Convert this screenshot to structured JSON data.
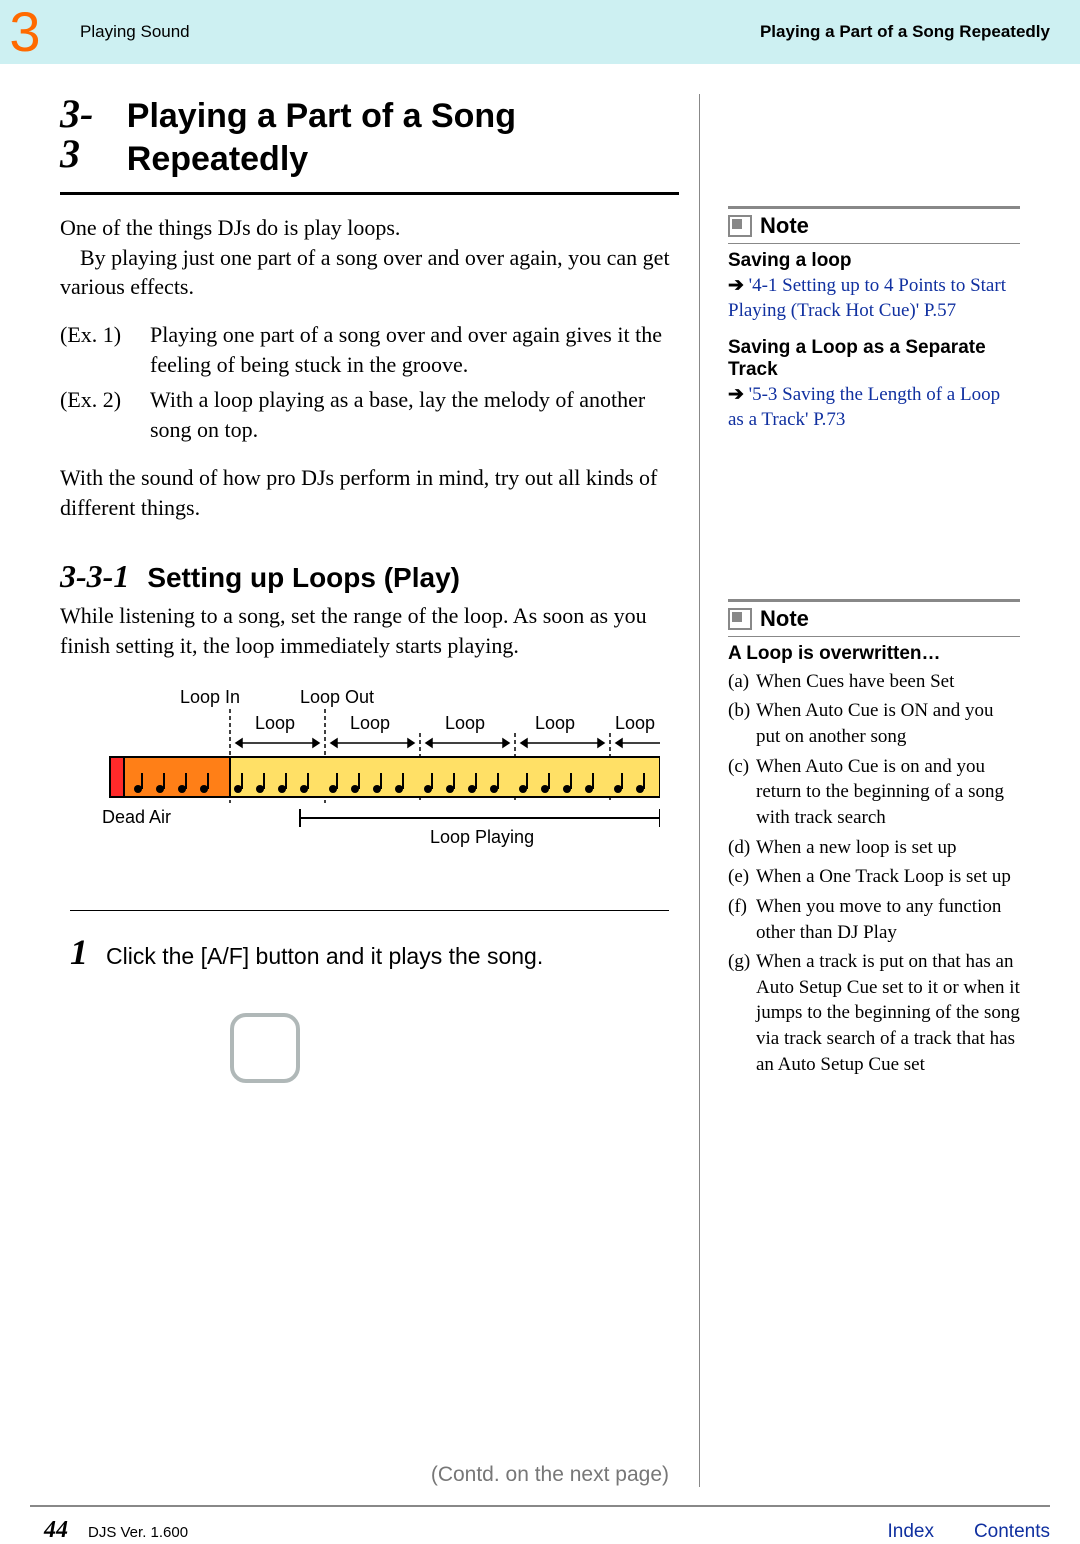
{
  "header": {
    "chapter": "3",
    "left": "Playing Sound",
    "right": "Playing a Part of a Song Repeatedly"
  },
  "section": {
    "num": "3-3",
    "title": "Playing a Part of a Song Repeatedly",
    "intro1": "One of the things DJs do is play loops.",
    "intro2": "By playing just one part of a song over and over again, you can get various effects.",
    "ex1_label": "(Ex. 1)",
    "ex1_text": "Playing one part of a song over and over again gives it the feeling of being stuck in the groove.",
    "ex2_label": "(Ex. 2)",
    "ex2_text": "With a loop playing as a base, lay the melody of another song on top.",
    "outro": "With the sound of how pro DJs perform in mind, try out all kinds of different things."
  },
  "subsection": {
    "num": "3-3-1",
    "title": "Setting up Loops (Play)",
    "text": "While listening to a song, set the range of the loop. As soon as you finish setting it, the loop immediately starts playing."
  },
  "diagram": {
    "loop_in": "Loop In",
    "loop_out": "Loop Out",
    "loop": "Loop",
    "dead_air": "Dead Air",
    "loop_playing": "Loop Playing"
  },
  "step1": {
    "num": "1",
    "text": "Click the [A/F] button and it plays the song."
  },
  "contd": "(Contd. on the next page)",
  "note1": {
    "label": "Note",
    "sub1": "Saving a loop",
    "link1": "'4-1 Setting up to 4 Points to Start Playing (Track Hot Cue)' P.57",
    "sub2": "Saving a Loop as a Separate Track",
    "link2": "'5-3 Saving the Length of a Loop as a Track' P.73"
  },
  "note2": {
    "label": "Note",
    "sub": "A Loop is overwritten…",
    "items": {
      "a": {
        "lbl": "(a)",
        "txt": "When Cues have been Set"
      },
      "b": {
        "lbl": "(b)",
        "txt": "When Auto Cue is ON and you put on another song"
      },
      "c": {
        "lbl": "(c)",
        "txt": "When Auto Cue is on and you return to the beginning of a song with track search"
      },
      "d": {
        "lbl": "(d)",
        "txt": "When a new loop is set up"
      },
      "e": {
        "lbl": "(e)",
        "txt": "When a One Track Loop is set up"
      },
      "f": {
        "lbl": "(f)",
        "txt": "When you move to any function other than DJ Play"
      },
      "g": {
        "lbl": "(g)",
        "txt": "When a track is put on that has an Auto Setup Cue set to it or when it jumps to the beginning of the song via track search of a track that has an Auto Setup Cue set"
      }
    }
  },
  "footer": {
    "page": "44",
    "ver": "DJS Ver. 1.600",
    "index": "Index",
    "contents": "Contents"
  },
  "arrow": "➔"
}
